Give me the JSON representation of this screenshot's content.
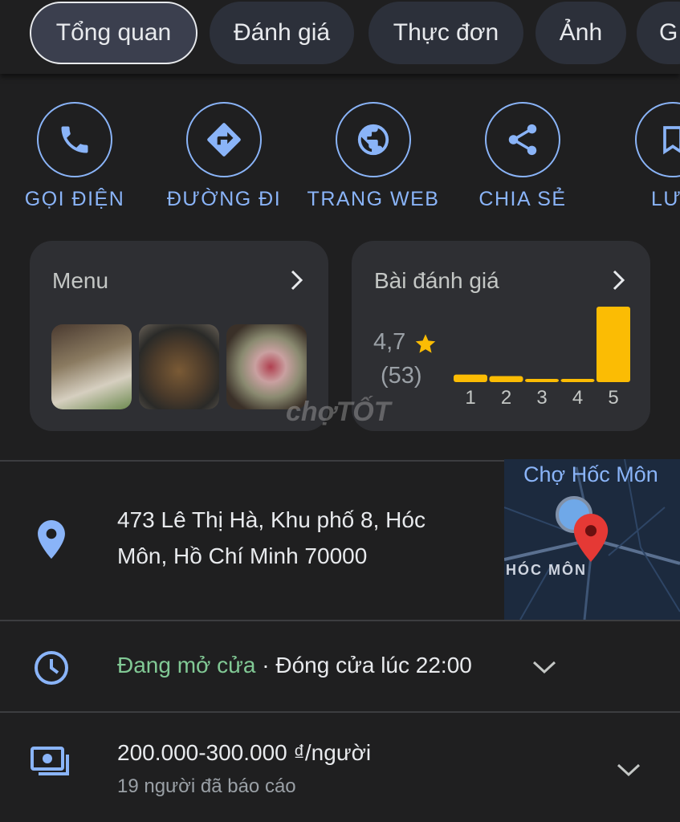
{
  "tabs": [
    {
      "label": "Tổng quan",
      "selected": true
    },
    {
      "label": "Đánh giá"
    },
    {
      "label": "Thực đơn"
    },
    {
      "label": "Ảnh"
    },
    {
      "label": "G"
    }
  ],
  "actions": [
    {
      "label": "GỌI ĐIỆN",
      "icon": "phone-icon"
    },
    {
      "label": "ĐƯỜNG ĐI",
      "icon": "directions-icon"
    },
    {
      "label": "TRANG WEB",
      "icon": "globe-icon"
    },
    {
      "label": "CHIA SẺ",
      "icon": "share-icon"
    },
    {
      "label": "LƯ",
      "icon": "bookmark-icon"
    }
  ],
  "menu_card": {
    "title": "Menu"
  },
  "review_card": {
    "title": "Bài đánh giá",
    "rating": "4,7",
    "count": "(53)",
    "star_color": "#fbbc04"
  },
  "chart_data": {
    "type": "bar",
    "categories": [
      "1",
      "2",
      "3",
      "4",
      "5"
    ],
    "values": [
      0.1,
      0.08,
      0.04,
      0.04,
      1.0
    ],
    "color": "#fbbc04"
  },
  "watermark": "chợTỐT",
  "address": {
    "text_line1": "473 Lê Thị Hà, Khu phố 8, Hóc",
    "text_line2": "Môn, Hồ Chí Minh 70000",
    "map_label_poi": "Chợ Hốc Môn",
    "map_label_area": "HÓC MÔN"
  },
  "hours": {
    "status": "Đang mở cửa",
    "detail": " · Đóng cửa lúc 22:00",
    "status_color": "#81c995"
  },
  "price": {
    "range": "200.000-300.000 ₫/người",
    "note": "19 người đã báo cáo"
  },
  "accent": "#8ab4f8"
}
